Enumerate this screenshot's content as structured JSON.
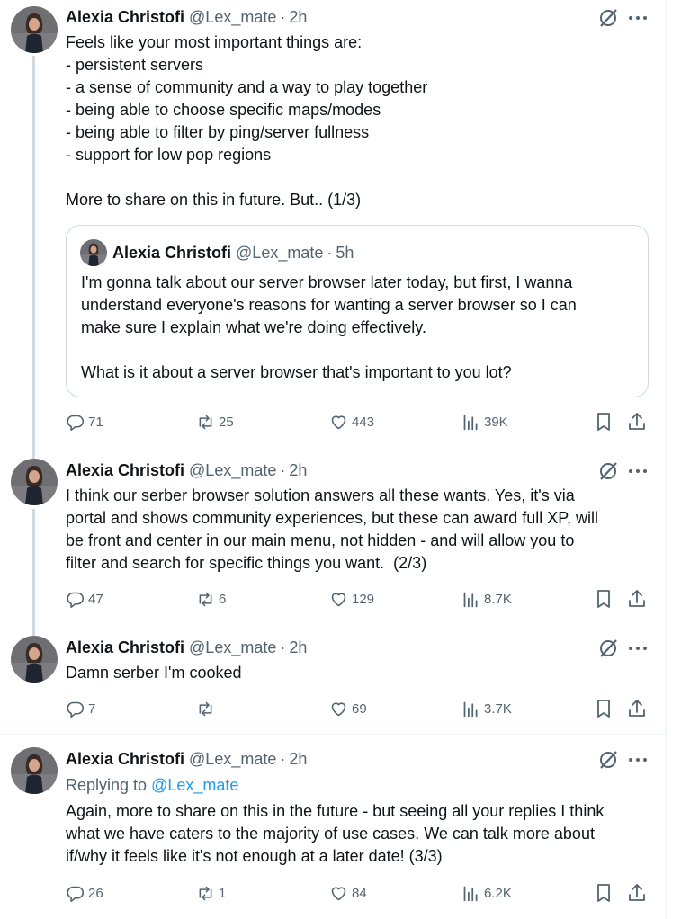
{
  "tweets": [
    {
      "name": "Alexia Christofi",
      "handle": "@Lex_mate",
      "sep": "·",
      "time": "2h",
      "lines": [
        "Feels like your most important things are:",
        "- persistent servers",
        "- a sense of community and a way to play together",
        "- being able to choose specific maps/modes",
        "- being able to filter by ping/server fullness",
        "- support for low pop regions",
        "",
        "More to share on this in future. But.. (1/3)"
      ],
      "quote": {
        "name": "Alexia Christofi",
        "handle": "@Lex_mate",
        "sep": "·",
        "time": "5h",
        "lines": [
          "I'm gonna talk about our server browser later today, but first, I wanna",
          "understand everyone's reasons for wanting a server browser so I can",
          "make sure I explain what we're doing effectively.",
          "",
          "What is it about a server browser that's important to you lot?"
        ]
      },
      "replies": "71",
      "reposts": "25",
      "likes": "443",
      "views": "39K"
    },
    {
      "name": "Alexia Christofi",
      "handle": "@Lex_mate",
      "sep": "·",
      "time": "2h",
      "lines": [
        "I think our serber browser solution answers all these wants. Yes, it's via",
        "portal and shows community experiences, but these can award full XP, will",
        "be front and center in our main menu, not hidden - and will allow you to",
        "filter and search for specific things you want.  (2/3)"
      ],
      "replies": "47",
      "reposts": "6",
      "likes": "129",
      "views": "8.7K"
    },
    {
      "name": "Alexia Christofi",
      "handle": "@Lex_mate",
      "sep": "·",
      "time": "2h",
      "lines": [
        "Damn serber I'm cooked"
      ],
      "replies": "7",
      "reposts": "",
      "likes": "69",
      "views": "3.7K"
    },
    {
      "name": "Alexia Christofi",
      "handle": "@Lex_mate",
      "sep": "·",
      "time": "2h",
      "replying_prefix": "Replying to",
      "replying_mention": "@Lex_mate",
      "lines": [
        "Again, more to share on this in the future - but seeing all your replies I think",
        "what we have caters to the majority of use cases. We can talk more about",
        "if/why it feels like it's not enough at a later date! (3/3)"
      ],
      "replies": "26",
      "reposts": "1",
      "likes": "84",
      "views": "6.2K"
    }
  ],
  "icons": {
    "reply": "reply-icon",
    "repost": "repost-icon",
    "like": "heart-icon",
    "views": "views-icon",
    "bookmark": "bookmark-icon",
    "share": "share-icon",
    "grok": "grok-icon",
    "more": "more-icon"
  },
  "colors": {
    "text": "#0f1419",
    "muted": "#536471",
    "link": "#1d9bf0",
    "border": "#cfd9de",
    "avatar_bg": "#6f6f73"
  }
}
